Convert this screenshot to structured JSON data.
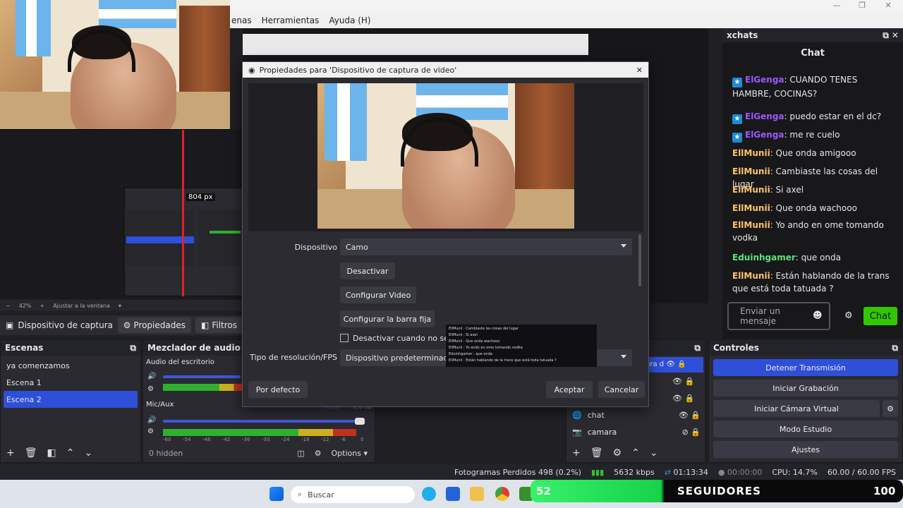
{
  "menubar": {
    "items": [
      "enas",
      "Herramientas",
      "Ayuda (H)"
    ]
  },
  "preview": {
    "zoom": "42%",
    "fit": "Ajustar a la ventana",
    "measure": "804 px"
  },
  "source_toolbar": {
    "source_name": "Dispositivo de captura de v",
    "properties": "Propiedades",
    "filters": "Filtros"
  },
  "scenes": {
    "title": "Escenas",
    "items": [
      "ya comenzamos",
      "Escena 1",
      "Escena 2"
    ],
    "selected": 2
  },
  "mixer": {
    "title": "Mezclador de audio",
    "channels": [
      {
        "name": "Audio del escritorio",
        "level": 0.38
      },
      {
        "name": "Mic/Aux",
        "level": 0.94,
        "tag": "Global",
        "db": "0.0 dB"
      }
    ],
    "scale": [
      "-60",
      "-54",
      "-48",
      "-42",
      "-36",
      "-30",
      "-24",
      "-18",
      "-12",
      "-6",
      "0"
    ],
    "hidden": "0 hidden",
    "options": "Options"
  },
  "sources": {
    "items": [
      {
        "name": "chat"
      },
      {
        "name": "camara"
      }
    ],
    "partial": "ura d"
  },
  "controls": {
    "title": "Controles",
    "buttons": [
      "Detener Transmisión",
      "Iniciar Grabación",
      "Iniciar Cámara Virtual",
      "Modo Estudio",
      "Ajustes"
    ]
  },
  "chat": {
    "dock_title": "xchats",
    "title": "Chat",
    "messages": [
      {
        "user": "ElGenga",
        "text": ": CUANDO TENES HAMBRE, COCINAS?",
        "color": "#9b59ff",
        "badge": true
      },
      {
        "user": "ElGenga",
        "text": ": puedo estar en el dc?",
        "color": "#9b59ff",
        "badge": true
      },
      {
        "user": "ElGenga",
        "text": ": me re cuelo",
        "color": "#9b59ff",
        "badge": true
      },
      {
        "user": "EllMunii",
        "text": ": Que onda amigooo",
        "color": "#ffc46b",
        "badge": false
      },
      {
        "user": "EllMunii",
        "text": ": Cambiaste las cosas del lugar",
        "color": "#ffc46b",
        "badge": false
      },
      {
        "user": "EllMunii",
        "text": ": Si axel",
        "color": "#ffc46b",
        "badge": false
      },
      {
        "user": "EllMunii",
        "text": ": Que onda wachooo",
        "color": "#ffc46b",
        "badge": false
      },
      {
        "user": "EllMunii",
        "text": ": Yo ando en ome tomando vodka",
        "color": "#ffc46b",
        "badge": false
      },
      {
        "user": "Eduinhgamer",
        "text": ": que onda",
        "color": "#5fe07a",
        "badge": false
      },
      {
        "user": "EllMunii",
        "text": ": Están hablando de la trans que está toda tatuada ?",
        "color": "#ffc46b",
        "badge": false
      }
    ],
    "input_placeholder": "Enviar un mensaje",
    "send": "Chat"
  },
  "dialog": {
    "title": "Propiedades para 'Dispositivo de captura de video'",
    "device_label": "Dispositivo",
    "device_value": "Camo",
    "btn_deactivate": "Desactivar",
    "btn_config_video": "Configurar Video",
    "btn_config_bar": "Configurar la barra fija",
    "checkbox_label": "Desactivar cuando no se muestre",
    "res_label": "Tipo de resolución/FPS",
    "res_value": "Dispositivo predeterminado",
    "defaults": "Por defecto",
    "accept": "Aceptar",
    "cancel": "Cancelar"
  },
  "status": {
    "dropped": "Fotogramas Perdidos 498 (0.2%)",
    "bitrate": "5632 kbps",
    "live_time": "01:13:34",
    "rec_time": "00:00:00",
    "cpu": "CPU: 14.7%",
    "fps": "60.00 / 60.00 FPS"
  },
  "taskbar": {
    "search": "Buscar"
  },
  "followers": {
    "current": "52",
    "label": "SEGUIDORES",
    "goal": "100"
  },
  "mini_chat": [
    "EllMunii : Cambiaste las cosas del lugar",
    "EllMunii : Si axel",
    "EllMunii : Que onda wachooo",
    "EllMunii : Yo ando en ome tomando vodka",
    "Eduinhgamer : que onda",
    "EllMunii : Están hablando de la trans que está toda tatuada ?"
  ]
}
